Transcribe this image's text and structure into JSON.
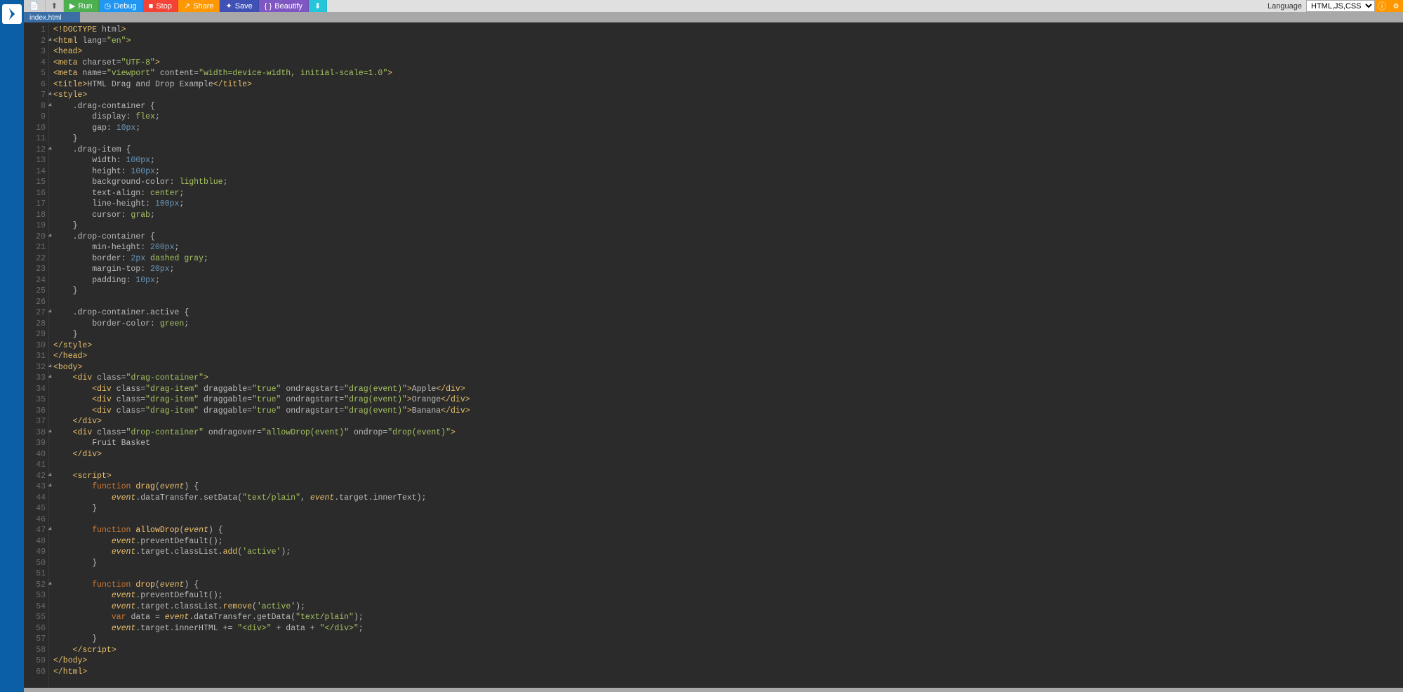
{
  "toolbar": {
    "new_file": "",
    "upload": "",
    "run": "Run",
    "debug": "Debug",
    "stop": "Stop",
    "share": "Share",
    "save": "Save",
    "beautify": "Beautify",
    "language_label": "Language",
    "language_value": "HTML,JS,CSS"
  },
  "tabs": {
    "active": "index.html"
  },
  "code_lines": [
    "<!DOCTYPE html>",
    "<html lang=\"en\">",
    "<head>",
    "<meta charset=\"UTF-8\">",
    "<meta name=\"viewport\" content=\"width=device-width, initial-scale=1.0\">",
    "<title>HTML Drag and Drop Example</title>",
    "<style>",
    "    .drag-container {",
    "        display: flex;",
    "        gap: 10px;",
    "    }",
    "    .drag-item {",
    "        width: 100px;",
    "        height: 100px;",
    "        background-color: lightblue;",
    "        text-align: center;",
    "        line-height: 100px;",
    "        cursor: grab;",
    "    }",
    "    .drop-container {",
    "        min-height: 200px;",
    "        border: 2px dashed gray;",
    "        margin-top: 20px;",
    "        padding: 10px;",
    "    }",
    "",
    "    .drop-container.active {",
    "        border-color: green;",
    "    }",
    "</style>",
    "</head>",
    "<body>",
    "    <div class=\"drag-container\">",
    "        <div class=\"drag-item\" draggable=\"true\" ondragstart=\"drag(event)\">Apple</div>",
    "        <div class=\"drag-item\" draggable=\"true\" ondragstart=\"drag(event)\">Orange</div>",
    "        <div class=\"drag-item\" draggable=\"true\" ondragstart=\"drag(event)\">Banana</div>",
    "    </div>",
    "    <div class=\"drop-container\" ondragover=\"allowDrop(event)\" ondrop=\"drop(event)\">",
    "        Fruit Basket",
    "    </div>",
    "",
    "    <script>",
    "        function drag(event) {",
    "            event.dataTransfer.setData(\"text/plain\", event.target.innerText);",
    "        }",
    "",
    "        function allowDrop(event) {",
    "            event.preventDefault();",
    "            event.target.classList.add('active');",
    "        }",
    "",
    "        function drop(event) {",
    "            event.preventDefault();",
    "            event.target.classList.remove('active');",
    "            var data = event.dataTransfer.getData(\"text/plain\");",
    "            event.target.innerHTML += \"<div>\" + data + \"</div>\";",
    "        }",
    "    </script>",
    "</body>",
    "</html>"
  ],
  "fold_lines": [
    2,
    7,
    8,
    12,
    20,
    27,
    32,
    33,
    38,
    42,
    43,
    47,
    52
  ]
}
